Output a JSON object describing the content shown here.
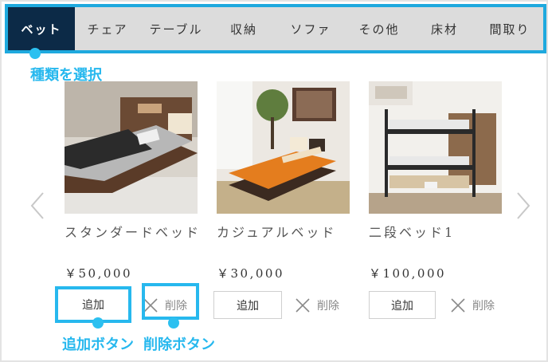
{
  "tabs": [
    {
      "label": "ベット",
      "active": true
    },
    {
      "label": "チェア",
      "active": false
    },
    {
      "label": "テーブル",
      "active": false
    },
    {
      "label": "収納",
      "active": false
    },
    {
      "label": "ソファ",
      "active": false
    },
    {
      "label": "その他",
      "active": false
    },
    {
      "label": "床材",
      "active": false
    },
    {
      "label": "間取り",
      "active": false
    }
  ],
  "callouts": {
    "tab_select": "種類を選択",
    "add_button": "追加ボタン",
    "delete_button": "削除ボタン"
  },
  "products": [
    {
      "name": "スタンダードベッド",
      "price": "￥50,000",
      "add_label": "追加",
      "delete_label": "削除"
    },
    {
      "name": "カジュアルベッド",
      "price": "￥30,000",
      "add_label": "追加",
      "delete_label": "削除"
    },
    {
      "name": "二段ベッド1",
      "price": "￥100,000",
      "add_label": "追加",
      "delete_label": "削除"
    }
  ],
  "colors": {
    "accent": "#27b8ee",
    "active_tab": "#0c2a47",
    "tab_bar": "#dcdcdc"
  },
  "icons": {
    "prev": "chevron-left-icon",
    "next": "chevron-right-icon",
    "delete": "close-x-icon"
  }
}
